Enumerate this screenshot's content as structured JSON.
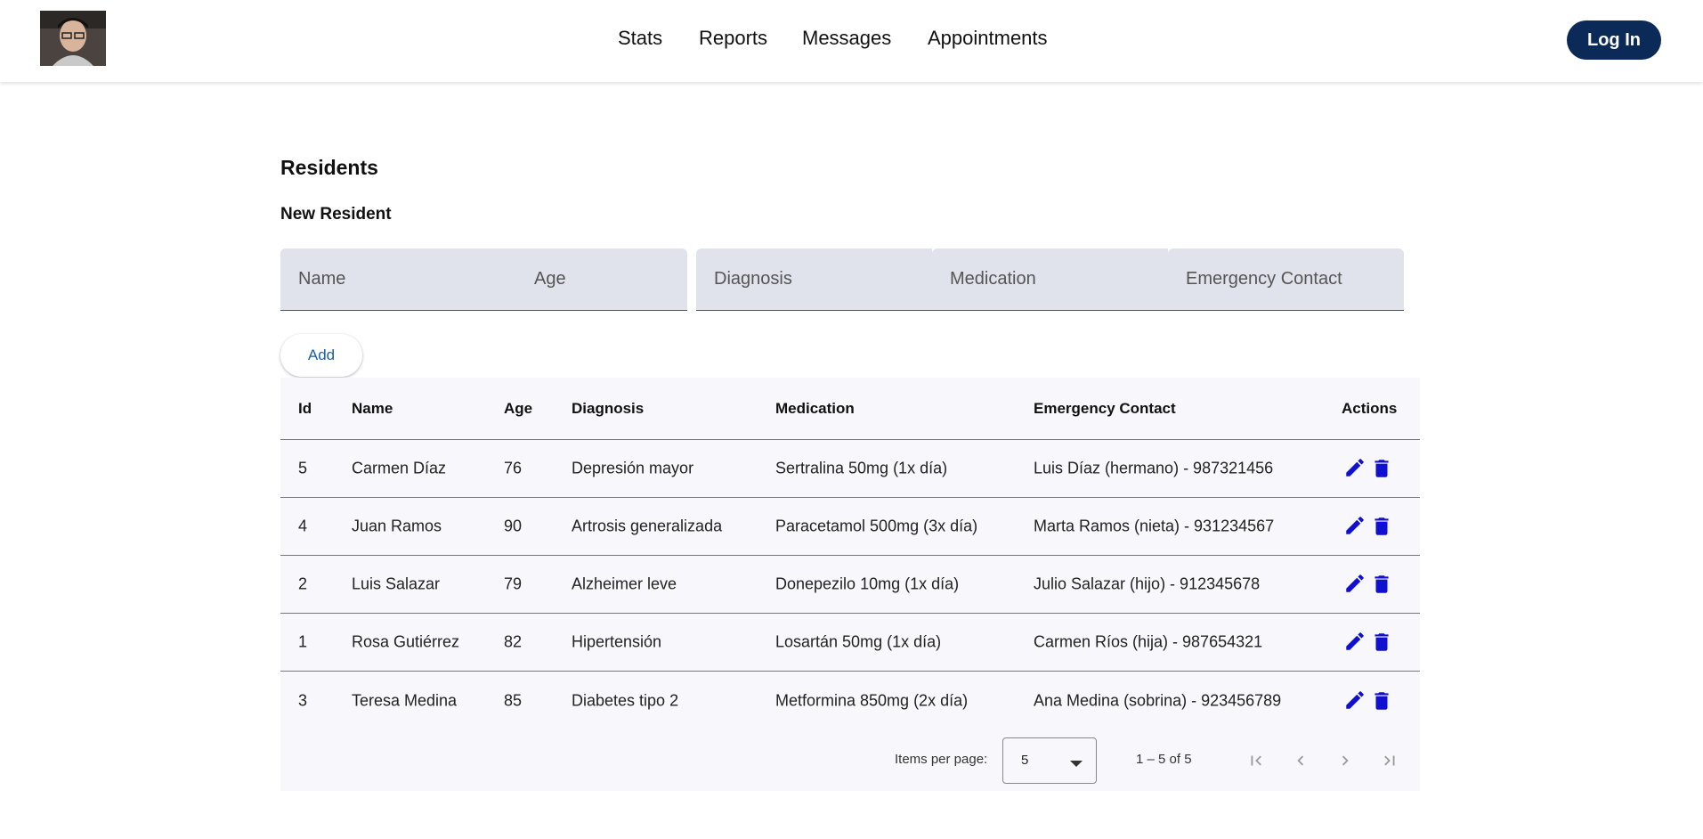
{
  "nav": {
    "items": [
      "Stats",
      "Reports",
      "Messages",
      "Appointments"
    ],
    "login_label": "Log In"
  },
  "page": {
    "title": "Residents",
    "form_title": "New Resident",
    "fields": {
      "name": "Name",
      "age": "Age",
      "diagnosis": "Diagnosis",
      "medication": "Medication",
      "emergency_contact": "Emergency Contact"
    },
    "add_label": "Add"
  },
  "table": {
    "columns": [
      "Id",
      "Name",
      "Age",
      "Diagnosis",
      "Medication",
      "Emergency Contact",
      "Actions"
    ],
    "rows": [
      {
        "id": "5",
        "name": "Carmen Díaz",
        "age": "76",
        "diagnosis": "Depresión mayor",
        "medication": "Sertralina 50mg (1x día)",
        "contact": "Luis Díaz (hermano) - 987321456"
      },
      {
        "id": "4",
        "name": "Juan Ramos",
        "age": "90",
        "diagnosis": "Artrosis generalizada",
        "medication": "Paracetamol 500mg (3x día)",
        "contact": "Marta Ramos (nieta) - 931234567"
      },
      {
        "id": "2",
        "name": "Luis Salazar",
        "age": "79",
        "diagnosis": "Alzheimer leve",
        "medication": "Donepezilo 10mg (1x día)",
        "contact": "Julio Salazar (hijo) - 912345678"
      },
      {
        "id": "1",
        "name": "Rosa Gutiérrez",
        "age": "82",
        "diagnosis": "Hipertensión",
        "medication": "Losartán 50mg (1x día)",
        "contact": "Carmen Ríos (hija) - 987654321"
      },
      {
        "id": "3",
        "name": "Teresa Medina",
        "age": "85",
        "diagnosis": "Diabetes tipo 2",
        "medication": "Metformina 850mg (2x día)",
        "contact": "Ana Medina (sobrina) - 923456789"
      }
    ],
    "action_icons": [
      "edit-icon",
      "delete-icon"
    ],
    "action_color": "#1010d0"
  },
  "paginator": {
    "items_per_page_label": "Items per page:",
    "page_size": "5",
    "range_label": "1 – 5 of 5",
    "buttons": [
      "first-page-icon",
      "previous-page-icon",
      "next-page-icon",
      "last-page-icon"
    ]
  }
}
